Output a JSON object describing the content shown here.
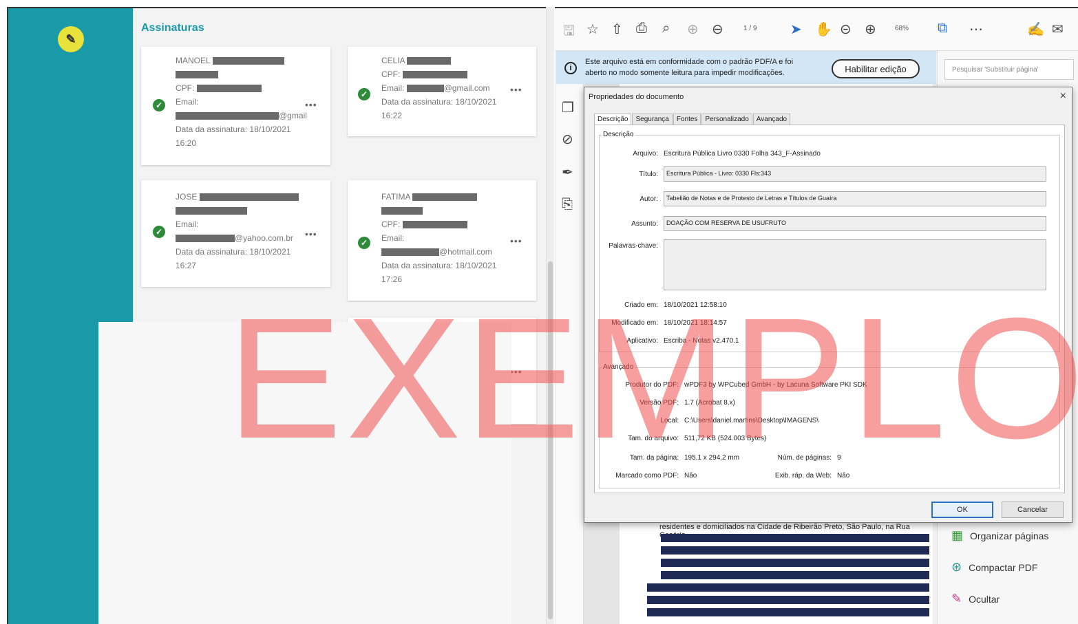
{
  "left_app": {
    "section_title": "Assinaturas",
    "more_label": "•••",
    "signatures": [
      {
        "name": "MANOEL",
        "cpf_label": "CPF:",
        "email_label": "Email:",
        "email_suffix": "@gmail",
        "date_label": "Data da assinatura: 18/10/2021",
        "time": "16:20"
      },
      {
        "name": "CELIA",
        "cpf_label": "CPF:",
        "email_label": "Email:",
        "email_suffix": "@gmail.com",
        "date_label": "Data da assinatura: 18/10/2021",
        "time": "16:22"
      },
      {
        "name": "JOSE",
        "cpf_label": "",
        "email_label": "Email:",
        "email_suffix": "@yahoo.com.br",
        "date_label": "Data da assinatura: 18/10/2021",
        "time": "16:27"
      },
      {
        "name": "FATIMA",
        "cpf_label": "CPF:",
        "email_label": "Email:",
        "email_suffix": "@hotmail.com",
        "date_label": "Data da assinatura: 18/10/2021",
        "time": "17:26"
      }
    ]
  },
  "acrobat": {
    "page_indicator": "1 / 9",
    "zoom": "68%",
    "info_text": "Este arquivo está em conformidade com o padrão PDF/A e foi aberto no modo somente leitura para impedir modificações.",
    "enable_edit_label": "Habilitar edição",
    "search_placeholder": "Pesquisar 'Substituir página'",
    "doc_text": "residentes e domiciliados na Cidade de Ribeirão Preto, São Paulo, na Rua Cesário",
    "tools": [
      {
        "label": "Organizar páginas"
      },
      {
        "label": "Compactar PDF"
      },
      {
        "label": "Ocultar"
      }
    ]
  },
  "dialog": {
    "title": "Propriedades do documento",
    "close": "×",
    "tabs": [
      "Descrição",
      "Segurança",
      "Fontes",
      "Personalizado",
      "Avançado"
    ],
    "description_group": "Descrição",
    "file_label": "Arquivo:",
    "file_value": "Escritura Pública Livro 0330 Folha 343_F-Assinado",
    "title_label": "Título:",
    "title_value": "Escritura Pública - Livro: 0330 Fls:343",
    "author_label": "Autor:",
    "author_value": "Tabelião de Notas e de Protesto de Letras e Títulos de Guaíra",
    "subject_label": "Assunto:",
    "subject_value": "DOAÇÃO COM RESERVA DE USUFRUTO",
    "keywords_label": "Palavras-chave:",
    "created_label": "Criado em:",
    "created_value": "18/10/2021 12:58:10",
    "modified_label": "Modificado em:",
    "modified_value": "18/10/2021 18:14:57",
    "app_label": "Aplicativo:",
    "app_value": "Escriba - Notas v2.470.1",
    "advanced_group": "Avançado",
    "producer_label": "Produtor do PDF:",
    "producer_value": "wPDF3 by WPCubed GmbH - by Lacuna Software PKI SDK",
    "version_label": "Versão PDF:",
    "version_value": "1.7 (Acrobat 8.x)",
    "location_label": "Local:",
    "location_value": "C:\\Users\\daniel.martins\\Desktop\\IMAGENS\\",
    "size_label": "Tam. do arquivo:",
    "size_value": "511,72 KB (524.003 Bytes)",
    "pagesize_label": "Tam. da página:",
    "pagesize_value": "195,1 x 294,2 mm",
    "pages_label": "Núm. de páginas:",
    "pages_value": "9",
    "tagged_label": "Marcado como PDF:",
    "tagged_value": "Não",
    "fastweb_label": "Exib. ráp. da Web:",
    "fastweb_value": "Não",
    "ok_label": "OK",
    "cancel_label": "Cancelar"
  },
  "watermark": "EXEMPLO"
}
